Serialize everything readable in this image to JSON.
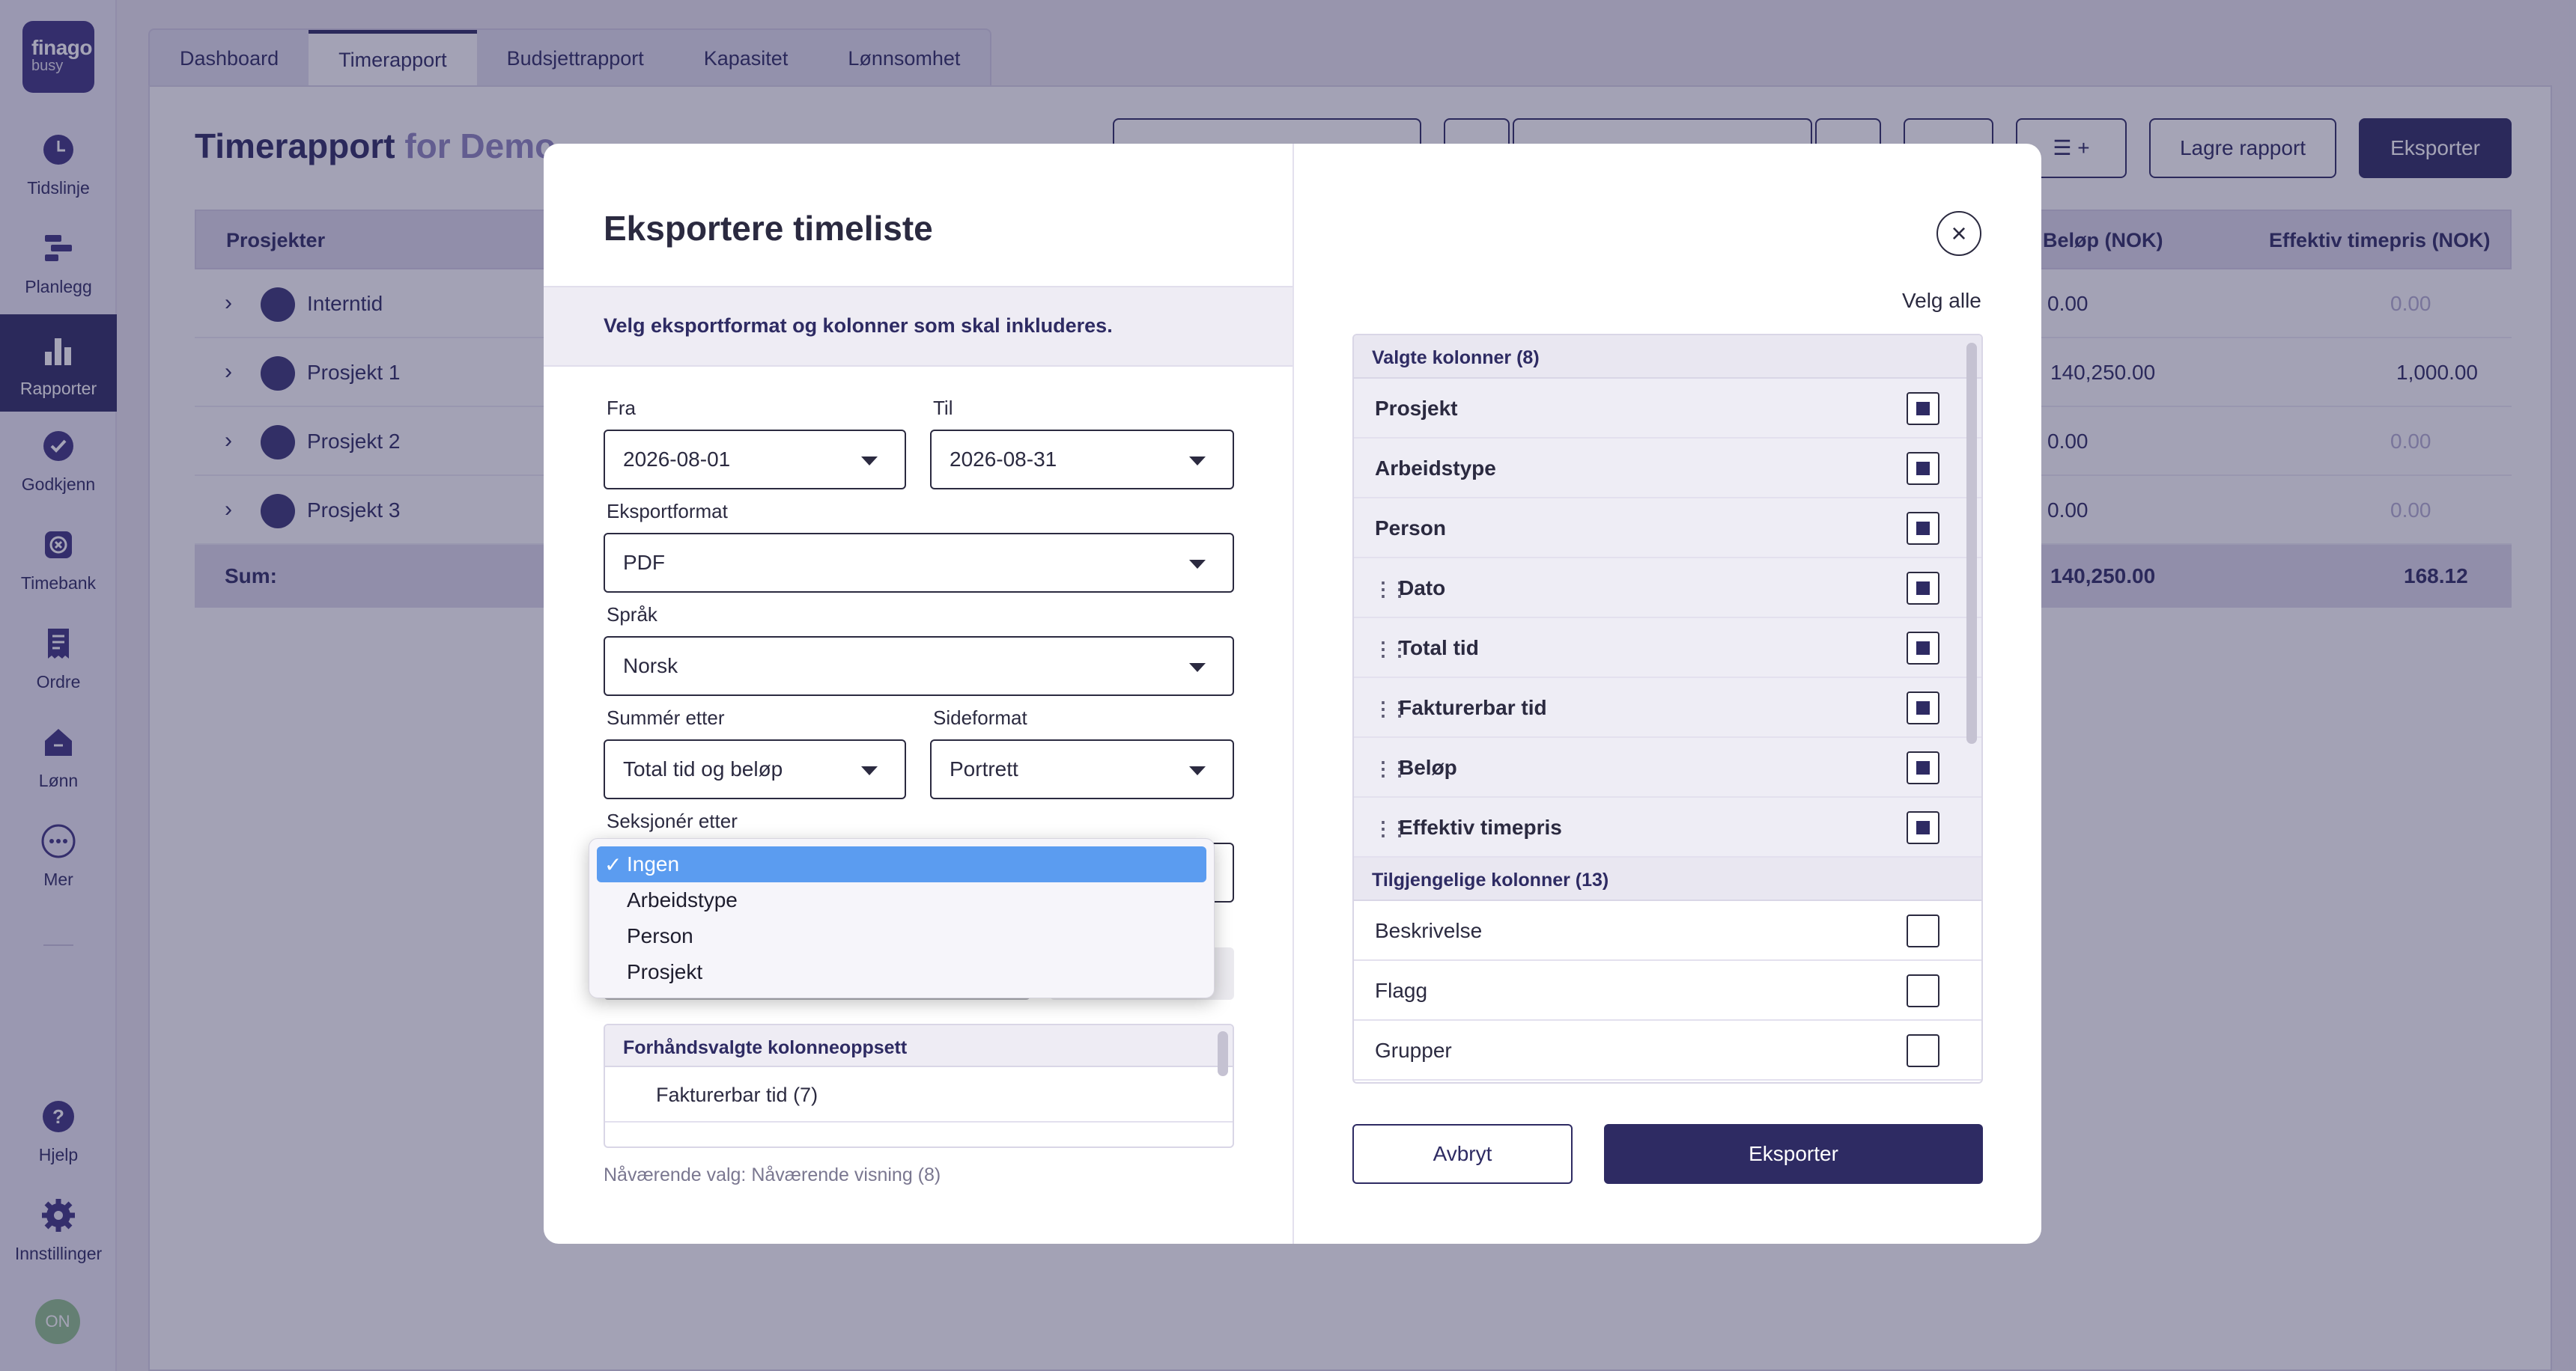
{
  "app": {
    "logo_line1": "finago",
    "logo_line2": "busy"
  },
  "sidebar": {
    "items": [
      {
        "label": "Tidslinje",
        "icon": "clock-icon"
      },
      {
        "label": "Planlegg",
        "icon": "planner-icon"
      },
      {
        "label": "Rapporter",
        "icon": "bar-chart-icon",
        "active": true
      },
      {
        "label": "Godkjenn",
        "icon": "check-circle-icon"
      },
      {
        "label": "Timebank",
        "icon": "timebank-icon"
      },
      {
        "label": "Ordre",
        "icon": "receipt-icon"
      },
      {
        "label": "Lønn",
        "icon": "salary-icon"
      },
      {
        "label": "Mer",
        "icon": "more-icon"
      }
    ],
    "help_label": "Hjelp",
    "settings_label": "Innstillinger",
    "avatar_initials": "ON"
  },
  "tabs": [
    "Dashboard",
    "Timerapport",
    "Budsjettrapport",
    "Kapasitet",
    "Lønnsomhet"
  ],
  "page": {
    "title": "Timerapport",
    "title_suffix": "for Demo",
    "save_report_label": "Lagre rapport",
    "export_label": "Eksporter",
    "filter_plus": "+",
    "table": {
      "headers": {
        "projects": "Prosjekter",
        "amount": "Beløp (NOK)",
        "eff_rate": "Effektiv timepris (NOK)"
      },
      "rows": [
        {
          "name": "Interntid",
          "amount": "0.00",
          "eff_rate": "0.00"
        },
        {
          "name": "Prosjekt 1",
          "amount": "140,250.00",
          "eff_rate": "1,000.00"
        },
        {
          "name": "Prosjekt 2",
          "amount": "0.00",
          "eff_rate": "0.00"
        },
        {
          "name": "Prosjekt 3",
          "amount": "0.00",
          "eff_rate": "0.00"
        }
      ],
      "sum_label": "Sum:",
      "sum_amount": "140,250.00",
      "sum_eff_rate": "168.12"
    }
  },
  "modal": {
    "title": "Eksportere timeliste",
    "banner": "Velg eksportformat og kolonner som skal inkluderes.",
    "from_label": "Fra",
    "from_value": "2026-08-01",
    "to_label": "Til",
    "to_value": "2026-08-31",
    "format_label": "Eksportformat",
    "format_value": "PDF",
    "language_label": "Språk",
    "language_value": "Norsk",
    "sum_by_label": "Summér etter",
    "sum_by_value": "Total tid og beløp",
    "page_format_label": "Sideformat",
    "page_format_value": "Portrett",
    "section_by_label": "Seksjonér etter",
    "section_options": [
      "Ingen",
      "Arbeidstype",
      "Person",
      "Prosjekt"
    ],
    "section_selected": "Ingen",
    "preset_header": "Forhåndsvalgte kolonneoppsett",
    "preset_items": [
      "Fakturerbar tid (7)"
    ],
    "current_selection": "Nåværende valg: Nåværende visning (8)",
    "select_all": "Velg alle",
    "selected_group": "Valgte kolonner (8)",
    "selected_columns": [
      "Prosjekt",
      "Arbeidstype",
      "Person",
      "Dato",
      "Total tid",
      "Fakturerbar tid",
      "Beløp",
      "Effektiv timepris"
    ],
    "available_group": "Tilgjengelige kolonner (13)",
    "available_columns": [
      "Beskrivelse",
      "Flagg",
      "Grupper"
    ],
    "cancel_label": "Avbryt",
    "export_label": "Eksporter"
  }
}
